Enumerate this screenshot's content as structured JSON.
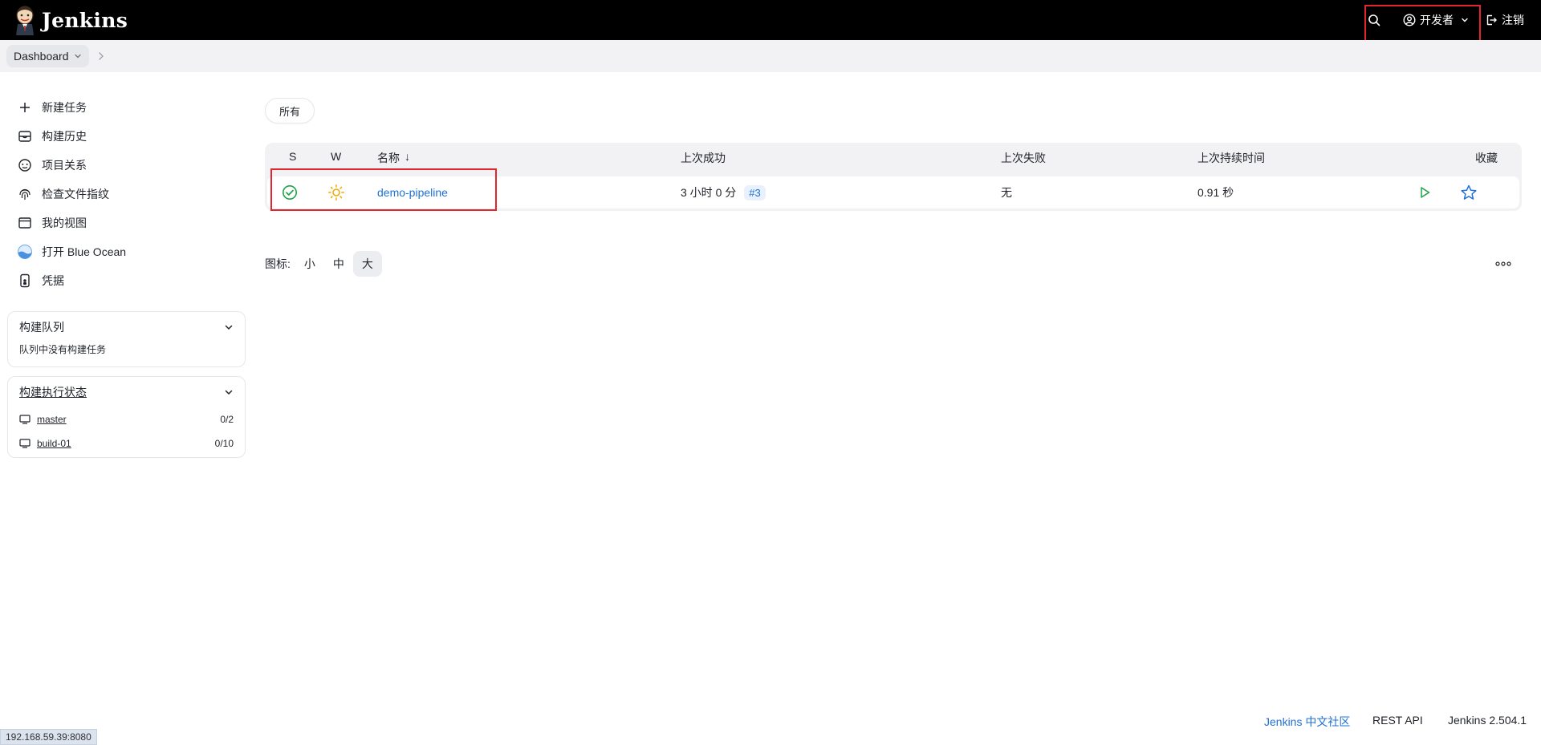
{
  "header": {
    "brand": "Jenkins",
    "user_label": "开发者",
    "logout_label": "注销"
  },
  "breadcrumb": {
    "item": "Dashboard"
  },
  "sidebar": {
    "tasks": [
      {
        "label": "新建任务",
        "icon": "plus-icon"
      },
      {
        "label": "构建历史",
        "icon": "history-icon"
      },
      {
        "label": "项目关系",
        "icon": "relationship-icon"
      },
      {
        "label": "检查文件指纹",
        "icon": "fingerprint-icon"
      },
      {
        "label": "我的视图",
        "icon": "view-icon"
      },
      {
        "label": "打开 Blue Ocean",
        "icon": "blue-ocean-icon"
      },
      {
        "label": "凭据",
        "icon": "credentials-icon"
      }
    ],
    "build_queue": {
      "title": "构建队列",
      "empty_text": "队列中没有构建任务"
    },
    "executors": {
      "title": "构建执行状态",
      "nodes": [
        {
          "name": "master",
          "status": "0/2"
        },
        {
          "name": "build-01",
          "status": "0/10"
        }
      ]
    }
  },
  "main": {
    "view_tab": "所有",
    "columns": {
      "s": "S",
      "w": "W",
      "name": "名称",
      "sort_arrow": "↓",
      "last_success": "上次成功",
      "last_failure": "上次失败",
      "last_duration": "上次持续时间",
      "favorite": "收藏"
    },
    "jobs": [
      {
        "status": "success",
        "weather": "sunny",
        "name": "demo-pipeline",
        "last_success": "3 小时 0 分",
        "last_success_build": "#3",
        "last_failure": "无",
        "last_duration": "0.91 秒"
      }
    ],
    "icon_size": {
      "label": "图标:",
      "options": [
        "小",
        "中",
        "大"
      ],
      "selected": "大"
    }
  },
  "footer": {
    "community_link": "Jenkins 中文社区",
    "rest_api": "REST API",
    "version": "Jenkins 2.504.1"
  },
  "status_bar": {
    "url": "192.168.59.39:8080"
  },
  "colors": {
    "header_bg": "#000000",
    "link": "#1d70d6",
    "success": "#1ea446",
    "weather": "#f0a800",
    "highlight": "#e3262c"
  }
}
